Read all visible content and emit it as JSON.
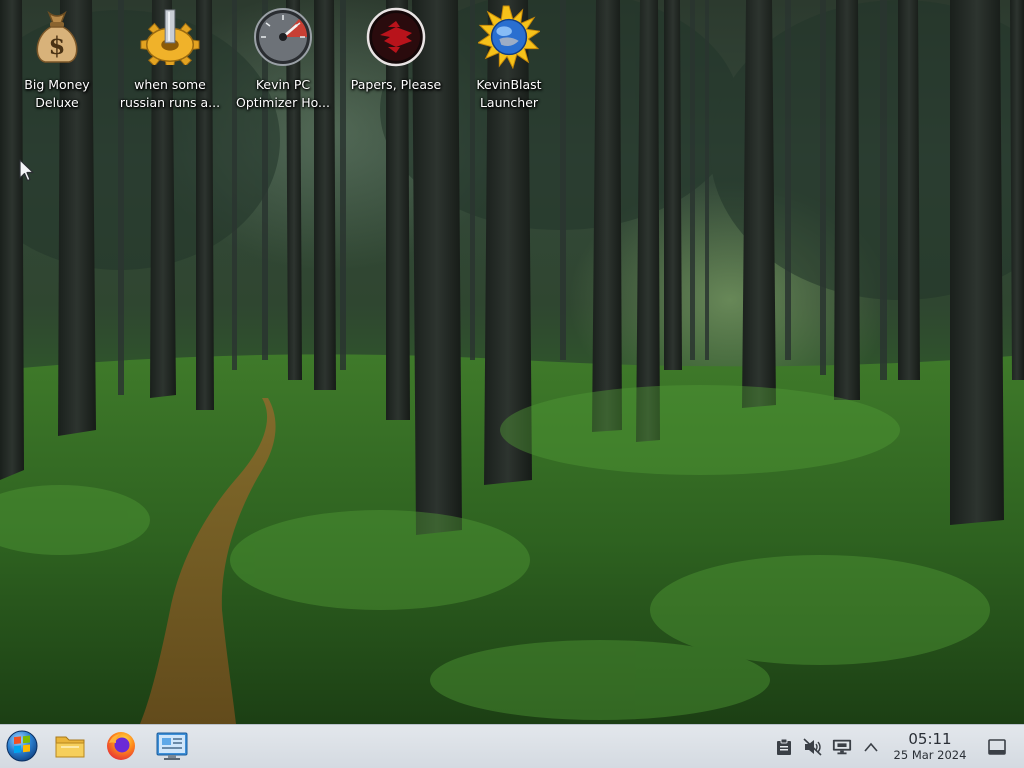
{
  "desktop": {
    "icons": [
      {
        "id": "big-money-deluxe",
        "label": "Big Money\nDeluxe",
        "icon": "money-bag-icon"
      },
      {
        "id": "when-some-russian",
        "label": "when some\nrussian runs a...",
        "icon": "gear-icon"
      },
      {
        "id": "kevin-pc-optimizer",
        "label": "Kevin PC\nOptimizer Ho...",
        "icon": "speedometer-icon"
      },
      {
        "id": "papers-please",
        "label": "Papers, Please",
        "icon": "papers-please-emblem-icon"
      },
      {
        "id": "kevinblast-launcher",
        "label": "KevinBlast\nLauncher",
        "icon": "blast-globe-icon"
      }
    ]
  },
  "taskbar": {
    "start_icon": "start-orb-icon",
    "pinned": [
      {
        "id": "file-manager",
        "icon": "folder-icon"
      },
      {
        "id": "firefox",
        "icon": "firefox-icon"
      },
      {
        "id": "control-panel",
        "icon": "control-panel-icon"
      }
    ],
    "tray": {
      "icons": [
        "clipboard-icon",
        "volume-muted-icon",
        "display-icon",
        "chevron-up-icon"
      ]
    },
    "clock": {
      "time": "05:11",
      "date": "25 Mar 2024"
    },
    "show_desktop_icon": "show-desktop-icon"
  },
  "colors": {
    "taskbar_bg": "#dde2e8",
    "label_text": "#ffffff",
    "moss_green": "#2f6a24"
  }
}
